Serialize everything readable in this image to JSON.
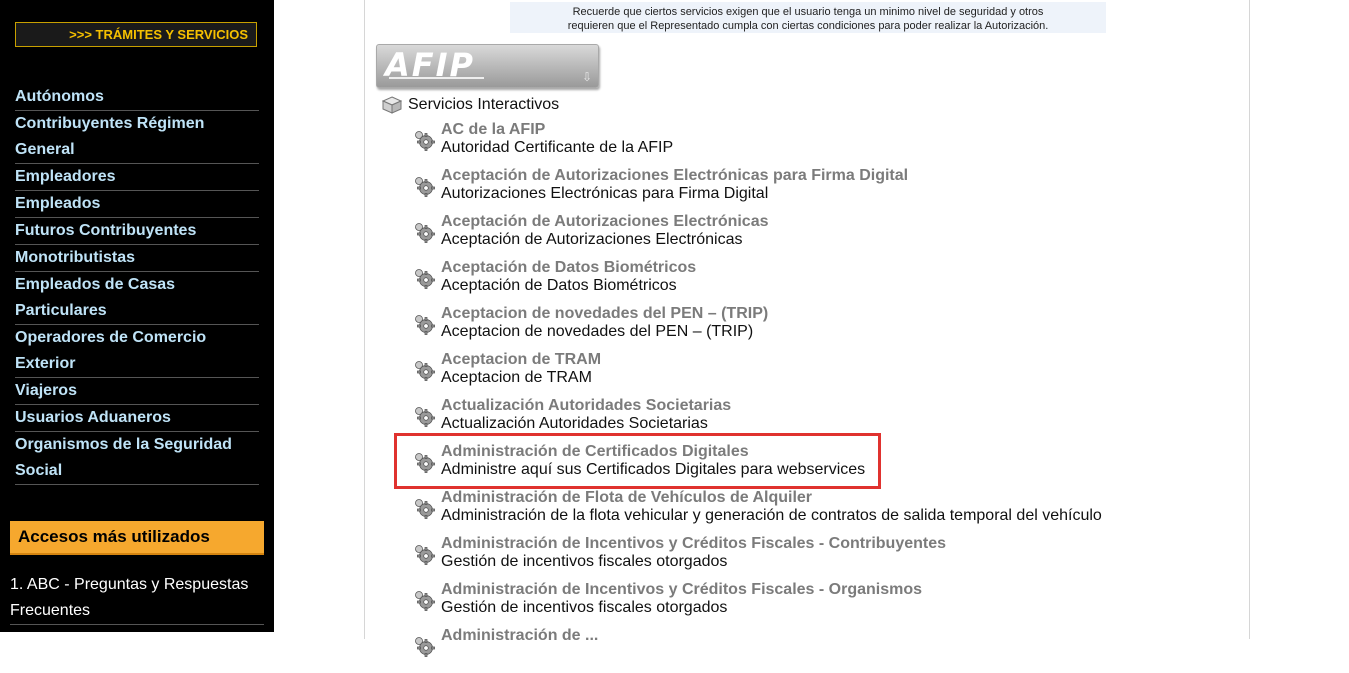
{
  "sidebar": {
    "tramites_label": ">>> TRÁMITES Y SERVICIOS",
    "nav": [
      "Autónomos",
      "Contribuyentes Régimen General",
      "Empleadores",
      "Empleados",
      "Futuros Contribuyentes",
      "Monotributistas",
      "Empleados de Casas Particulares",
      "Operadores de Comercio Exterior",
      "Viajeros",
      "Usuarios Aduaneros",
      "Organismos de la Seguridad Social"
    ],
    "accesos_title": "Accesos más utilizados",
    "accesos": [
      "1. ABC - Preguntas y Respuestas Frecuentes"
    ]
  },
  "notice": {
    "line1": "Recuerde que ciertos servicios exigen que el usuario tenga un minimo nivel de seguridad y otros",
    "line2": "requieren que el Representado cumpla con ciertas condiciones para poder realizar la Autorización."
  },
  "logo": {
    "text": "AFIP",
    "subtext": "ADMINISTRACION FEDERAL"
  },
  "tree": {
    "root_label": "Servicios Interactivos",
    "services": [
      {
        "title": "AC de la AFIP",
        "desc": "Autoridad Certificante de la AFIP"
      },
      {
        "title": "Aceptación de Autorizaciones Electrónicas para Firma Digital",
        "desc": "Autorizaciones Electrónicas para Firma Digital"
      },
      {
        "title": "Aceptación de Autorizaciones Electrónicas",
        "desc": "Aceptación de Autorizaciones Electrónicas"
      },
      {
        "title": "Aceptación de Datos Biométricos",
        "desc": "Aceptación de Datos Biométricos"
      },
      {
        "title": "Aceptacion de novedades del PEN – (TRIP)",
        "desc": "Aceptacion de novedades del PEN – (TRIP)"
      },
      {
        "title": "Aceptacion de TRAM",
        "desc": "Aceptacion de TRAM"
      },
      {
        "title": "Actualización Autoridades Societarias",
        "desc": "Actualización Autoridades Societarias"
      },
      {
        "title": "Administración de Certificados Digitales",
        "desc": "Administre aquí sus Certificados Digitales para webservices"
      },
      {
        "title": "Administración de Flota de Vehículos de Alquiler",
        "desc": "Administración de la flota vehicular y generación de contratos de salida temporal del vehículo"
      },
      {
        "title": "Administración de Incentivos y Créditos Fiscales - Contribuyentes",
        "desc": "Gestión de incentivos fiscales otorgados"
      },
      {
        "title": "Administración de Incentivos y Créditos Fiscales - Organismos",
        "desc": "Gestión de incentivos fiscales otorgados"
      },
      {
        "title": "Administración de ...",
        "desc": ""
      }
    ]
  },
  "colors": {
    "sidebar_bg": "#000000",
    "nav_link": "#bfe3f7",
    "accent_orange": "#f6a82e",
    "highlight_red": "#e0322f",
    "service_title": "#7b7b7b"
  }
}
